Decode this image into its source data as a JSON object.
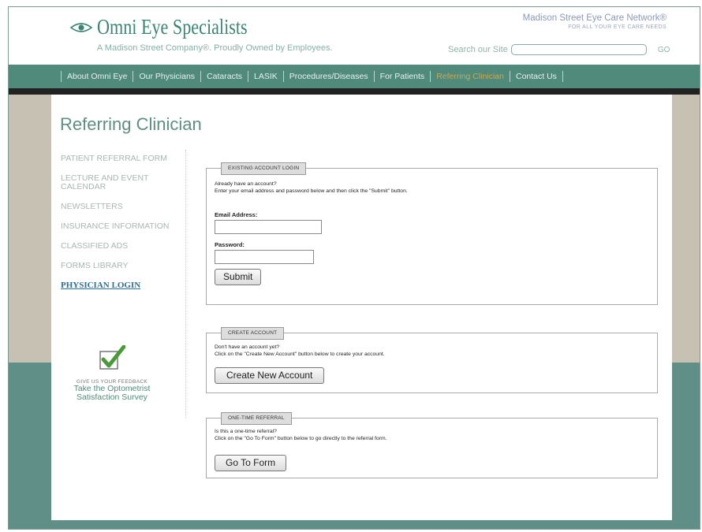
{
  "header": {
    "logo_text": "Omni Eye Specialists",
    "tagline": "A Madison Street Company®. Proudly Owned by Employees.",
    "network_title": "Madison Street Eye Care Network®",
    "network_sub": "FOR ALL YOUR EYE CARE NEEDS",
    "search_label": "Search our Site",
    "search_value": "",
    "search_go": "GO"
  },
  "nav": {
    "items": [
      {
        "label": "About Omni Eye"
      },
      {
        "label": "Our Physicians"
      },
      {
        "label": "Cataracts"
      },
      {
        "label": "LASIK"
      },
      {
        "label": "Procedures/Diseases"
      },
      {
        "label": "For Patients"
      },
      {
        "label": "Referring Clinician"
      },
      {
        "label": "Contact Us"
      }
    ]
  },
  "page_title": "Referring Clinician",
  "sidebar": {
    "items": [
      {
        "label": "PATIENT REFERRAL FORM"
      },
      {
        "label": "LECTURE AND EVENT CALENDAR"
      },
      {
        "label": "NEWSLETTERS"
      },
      {
        "label": "INSURANCE INFORMATION"
      },
      {
        "label": "CLASSIFIED ADS"
      },
      {
        "label": "FORMS LIBRARY"
      },
      {
        "label": "PHYSICIAN LOGIN"
      }
    ],
    "feedback_small": "GIVE US YOUR FEEDBACK",
    "feedback_link": "Take the Optometrist Satisfaction Survey"
  },
  "login": {
    "section_label": "EXISTING ACCOUNT LOGIN",
    "line1": "Already have an account?",
    "line2": "Enter your email address and password below and then click the \"Submit\" button.",
    "email_label": "Email Address:",
    "email_value": "",
    "password_label": "Password:",
    "password_value": "",
    "submit_label": "Submit"
  },
  "create": {
    "section_label": "CREATE ACCOUNT",
    "line1": "Don't have an account yet?",
    "line2": "Click on the \"Create New Account\" button below to create your account.",
    "button_label": "Create New Account"
  },
  "referral": {
    "section_label": "ONE-TIME REFERRAL",
    "line1": "Is this a one-time referral?",
    "line2": "Click on the \"Go To Form\" button below to go directly to the referral form.",
    "button_label": "Go To Form"
  },
  "colors": {
    "brand_teal": "#4f8a7b",
    "active_nav": "#c9a85a",
    "active_sidebar": "#2e6e8e"
  }
}
